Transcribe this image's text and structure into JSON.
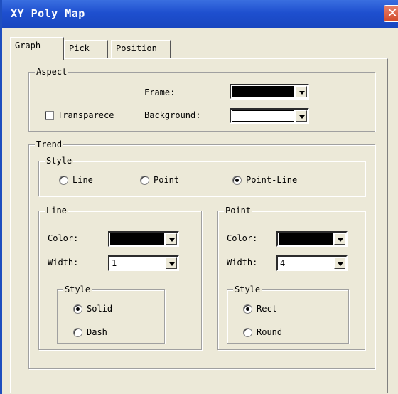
{
  "window": {
    "title": "XY Poly Map",
    "close_symbol": "✕"
  },
  "tabs": [
    {
      "label": "Graph",
      "active": true
    },
    {
      "label": "Pick"
    },
    {
      "label": "Position"
    }
  ],
  "aspect": {
    "legend": "Aspect",
    "frame_label": "Frame:",
    "frame_color": "#000000",
    "transparence_label": "Transparece",
    "transparence_checked": false,
    "background_label": "Background:",
    "background_color": "#ffffff"
  },
  "trend": {
    "legend": "Trend",
    "style": {
      "legend": "Style",
      "options": [
        "Line",
        "Point",
        "Point-Line"
      ],
      "selected": "Point-Line"
    },
    "line": {
      "legend": "Line",
      "color_label": "Color:",
      "color": "#000000",
      "width_label": "Width:",
      "width": "1",
      "style_legend": "Style",
      "style_options": [
        "Solid",
        "Dash"
      ],
      "style_selected": "Solid"
    },
    "point": {
      "legend": "Point",
      "color_label": "Color:",
      "color": "#000000",
      "width_label": "Width:",
      "width": "4",
      "style_legend": "Style",
      "style_options": [
        "Rect",
        "Round"
      ],
      "style_selected": "Rect"
    }
  }
}
